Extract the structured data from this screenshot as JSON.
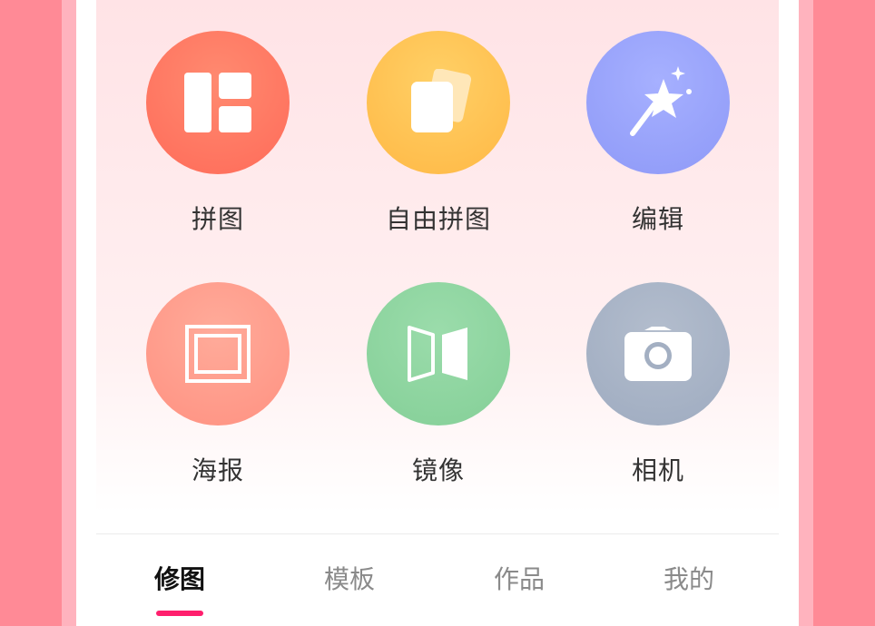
{
  "tools": [
    {
      "label": "拼图",
      "icon": "grid-layout-icon",
      "color": "#ff7a63"
    },
    {
      "label": "自由拼图",
      "icon": "stacked-cards-icon",
      "color": "#ffc352"
    },
    {
      "label": "编辑",
      "icon": "magic-wand-icon",
      "color": "#9aa6ff"
    },
    {
      "label": "海报",
      "icon": "poster-frame-icon",
      "color": "#ff9c8c"
    },
    {
      "label": "镜像",
      "icon": "mirror-icon",
      "color": "#8fd4a0"
    },
    {
      "label": "相机",
      "icon": "camera-icon",
      "color": "#a7b3c6"
    }
  ],
  "tabs": [
    {
      "label": "修图",
      "active": true
    },
    {
      "label": "模板",
      "active": false
    },
    {
      "label": "作品",
      "active": false
    },
    {
      "label": "我的",
      "active": false
    }
  ],
  "colors": {
    "background": "#ff8a96",
    "tab_active_indicator": "#ff1f6d"
  }
}
